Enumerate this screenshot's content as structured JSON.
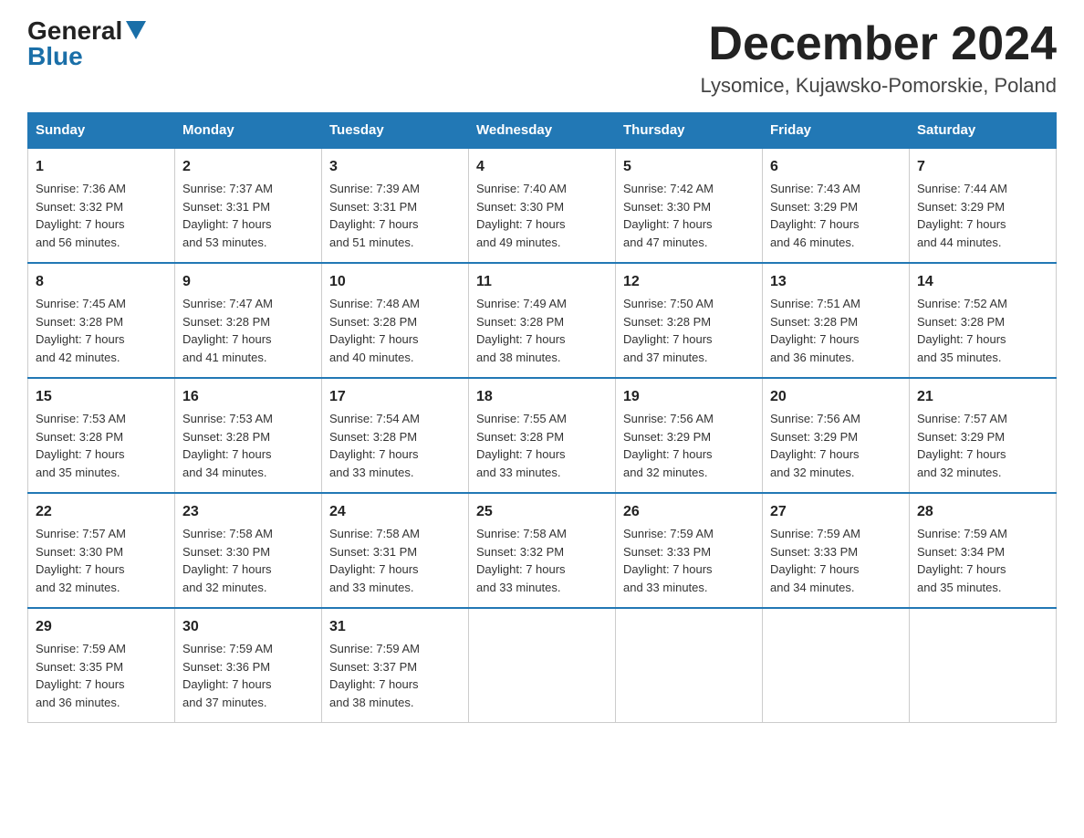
{
  "header": {
    "logo_general": "General",
    "logo_blue": "Blue",
    "month_title": "December 2024",
    "location": "Lysomice, Kujawsko-Pomorskie, Poland"
  },
  "days_of_week": [
    "Sunday",
    "Monday",
    "Tuesday",
    "Wednesday",
    "Thursday",
    "Friday",
    "Saturday"
  ],
  "weeks": [
    [
      {
        "day": "1",
        "sunrise": "7:36 AM",
        "sunset": "3:32 PM",
        "daylight": "7 hours and 56 minutes."
      },
      {
        "day": "2",
        "sunrise": "7:37 AM",
        "sunset": "3:31 PM",
        "daylight": "7 hours and 53 minutes."
      },
      {
        "day": "3",
        "sunrise": "7:39 AM",
        "sunset": "3:31 PM",
        "daylight": "7 hours and 51 minutes."
      },
      {
        "day": "4",
        "sunrise": "7:40 AM",
        "sunset": "3:30 PM",
        "daylight": "7 hours and 49 minutes."
      },
      {
        "day": "5",
        "sunrise": "7:42 AM",
        "sunset": "3:30 PM",
        "daylight": "7 hours and 47 minutes."
      },
      {
        "day": "6",
        "sunrise": "7:43 AM",
        "sunset": "3:29 PM",
        "daylight": "7 hours and 46 minutes."
      },
      {
        "day": "7",
        "sunrise": "7:44 AM",
        "sunset": "3:29 PM",
        "daylight": "7 hours and 44 minutes."
      }
    ],
    [
      {
        "day": "8",
        "sunrise": "7:45 AM",
        "sunset": "3:28 PM",
        "daylight": "7 hours and 42 minutes."
      },
      {
        "day": "9",
        "sunrise": "7:47 AM",
        "sunset": "3:28 PM",
        "daylight": "7 hours and 41 minutes."
      },
      {
        "day": "10",
        "sunrise": "7:48 AM",
        "sunset": "3:28 PM",
        "daylight": "7 hours and 40 minutes."
      },
      {
        "day": "11",
        "sunrise": "7:49 AM",
        "sunset": "3:28 PM",
        "daylight": "7 hours and 38 minutes."
      },
      {
        "day": "12",
        "sunrise": "7:50 AM",
        "sunset": "3:28 PM",
        "daylight": "7 hours and 37 minutes."
      },
      {
        "day": "13",
        "sunrise": "7:51 AM",
        "sunset": "3:28 PM",
        "daylight": "7 hours and 36 minutes."
      },
      {
        "day": "14",
        "sunrise": "7:52 AM",
        "sunset": "3:28 PM",
        "daylight": "7 hours and 35 minutes."
      }
    ],
    [
      {
        "day": "15",
        "sunrise": "7:53 AM",
        "sunset": "3:28 PM",
        "daylight": "7 hours and 35 minutes."
      },
      {
        "day": "16",
        "sunrise": "7:53 AM",
        "sunset": "3:28 PM",
        "daylight": "7 hours and 34 minutes."
      },
      {
        "day": "17",
        "sunrise": "7:54 AM",
        "sunset": "3:28 PM",
        "daylight": "7 hours and 33 minutes."
      },
      {
        "day": "18",
        "sunrise": "7:55 AM",
        "sunset": "3:28 PM",
        "daylight": "7 hours and 33 minutes."
      },
      {
        "day": "19",
        "sunrise": "7:56 AM",
        "sunset": "3:29 PM",
        "daylight": "7 hours and 32 minutes."
      },
      {
        "day": "20",
        "sunrise": "7:56 AM",
        "sunset": "3:29 PM",
        "daylight": "7 hours and 32 minutes."
      },
      {
        "day": "21",
        "sunrise": "7:57 AM",
        "sunset": "3:29 PM",
        "daylight": "7 hours and 32 minutes."
      }
    ],
    [
      {
        "day": "22",
        "sunrise": "7:57 AM",
        "sunset": "3:30 PM",
        "daylight": "7 hours and 32 minutes."
      },
      {
        "day": "23",
        "sunrise": "7:58 AM",
        "sunset": "3:30 PM",
        "daylight": "7 hours and 32 minutes."
      },
      {
        "day": "24",
        "sunrise": "7:58 AM",
        "sunset": "3:31 PM",
        "daylight": "7 hours and 33 minutes."
      },
      {
        "day": "25",
        "sunrise": "7:58 AM",
        "sunset": "3:32 PM",
        "daylight": "7 hours and 33 minutes."
      },
      {
        "day": "26",
        "sunrise": "7:59 AM",
        "sunset": "3:33 PM",
        "daylight": "7 hours and 33 minutes."
      },
      {
        "day": "27",
        "sunrise": "7:59 AM",
        "sunset": "3:33 PM",
        "daylight": "7 hours and 34 minutes."
      },
      {
        "day": "28",
        "sunrise": "7:59 AM",
        "sunset": "3:34 PM",
        "daylight": "7 hours and 35 minutes."
      }
    ],
    [
      {
        "day": "29",
        "sunrise": "7:59 AM",
        "sunset": "3:35 PM",
        "daylight": "7 hours and 36 minutes."
      },
      {
        "day": "30",
        "sunrise": "7:59 AM",
        "sunset": "3:36 PM",
        "daylight": "7 hours and 37 minutes."
      },
      {
        "day": "31",
        "sunrise": "7:59 AM",
        "sunset": "3:37 PM",
        "daylight": "7 hours and 38 minutes."
      },
      null,
      null,
      null,
      null
    ]
  ],
  "labels": {
    "sunrise": "Sunrise:",
    "sunset": "Sunset:",
    "daylight": "Daylight:"
  }
}
